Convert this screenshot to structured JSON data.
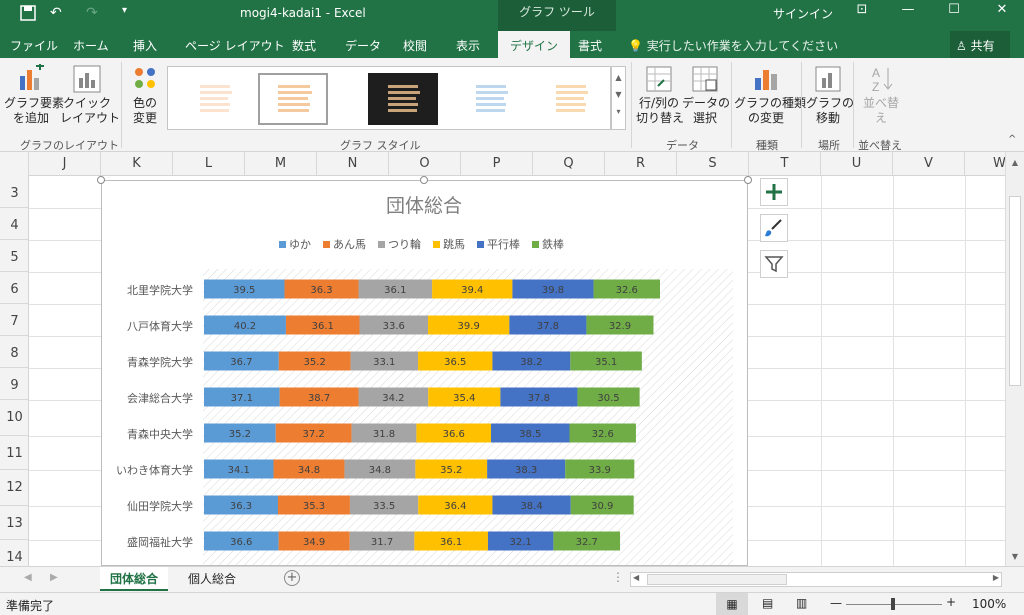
{
  "titlebar": {
    "doc_title": "mogi4-kadai1  -  Excel",
    "tool_tab": "グラフ ツール",
    "signin": "サインイン"
  },
  "tabs": [
    "ファイル",
    "ホーム",
    "挿入",
    "ページ レイアウト",
    "数式",
    "データ",
    "校閲",
    "表示",
    "デザイン",
    "書式"
  ],
  "active_tab": "デザイン",
  "tell_me": "実行したい作業を入力してください",
  "share": "共有",
  "ribbon": {
    "add_element": "グラフ要素\nを追加",
    "quick_layout": "クイック\nレイアウト",
    "change_colors": "色の\n変更",
    "switch_row_col": "行/列の\n切り替え",
    "select_data": "データの\n選択",
    "change_type": "グラフの種類\nの変更",
    "move_chart": "グラフの\n移動",
    "sort": "並べ替\nえ",
    "group_layout": "グラフのレイアウト",
    "group_styles": "グラフ スタイル",
    "group_data": "データ",
    "group_type": "種類",
    "group_location": "場所",
    "group_sort": "並べ替え"
  },
  "columns": [
    "J",
    "K",
    "L",
    "M",
    "N",
    "O",
    "P",
    "Q",
    "R",
    "S",
    "T",
    "U",
    "V",
    "W"
  ],
  "rows": [
    "3",
    "4",
    "5",
    "6",
    "7",
    "8",
    "9",
    "10",
    "11",
    "12",
    "13",
    "14"
  ],
  "chart_data": {
    "type": "bar",
    "title": "団体総合",
    "categories": [
      "北里学院大学",
      "八戸体育大学",
      "青森学院大学",
      "会津総合大学",
      "青森中央大学",
      "いわき体育大学",
      "仙田学院大学",
      "盛岡福祉大学"
    ],
    "series": [
      {
        "name": "ゆか",
        "color": "#5b9bd5",
        "values": [
          39.5,
          40.2,
          36.7,
          37.1,
          35.2,
          34.1,
          36.3,
          36.6
        ]
      },
      {
        "name": "あん馬",
        "color": "#ed7d31",
        "values": [
          36.3,
          36.1,
          35.2,
          38.7,
          37.2,
          34.8,
          35.3,
          34.9
        ]
      },
      {
        "name": "つり輪",
        "color": "#a5a5a5",
        "values": [
          36.1,
          33.6,
          33.1,
          34.2,
          31.8,
          34.8,
          33.5,
          31.7
        ]
      },
      {
        "name": "跳馬",
        "color": "#ffc000",
        "values": [
          39.4,
          39.9,
          36.5,
          35.4,
          36.6,
          35.2,
          36.4,
          36.1
        ]
      },
      {
        "name": "平行棒",
        "color": "#4472c4",
        "values": [
          39.8,
          37.8,
          38.2,
          37.8,
          38.5,
          38.3,
          38.4,
          32.1
        ]
      },
      {
        "name": "鉄棒",
        "color": "#70ad47",
        "values": [
          32.6,
          32.9,
          35.1,
          30.5,
          32.6,
          33.9,
          30.9,
          32.7
        ]
      }
    ],
    "xlim": [
      0,
      260
    ],
    "stacked": true,
    "grid": false,
    "legend": "top"
  },
  "sheets": [
    "団体総合",
    "個人総合"
  ],
  "active_sheet": "団体総合",
  "status": "準備完了",
  "zoom": "100%"
}
